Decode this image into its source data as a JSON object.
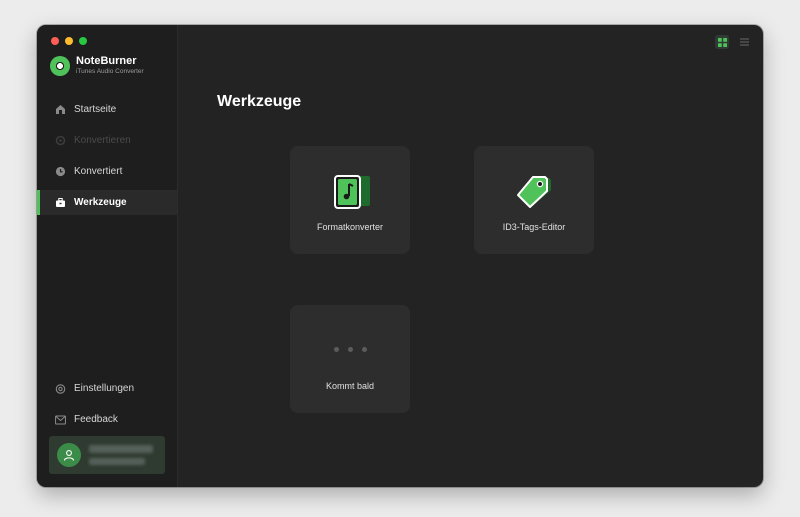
{
  "app": {
    "name": "NoteBurner",
    "subtitle": "iTunes Audio Converter"
  },
  "sidebar": {
    "items": [
      {
        "label": "Startseite",
        "icon": "home-icon",
        "state": "normal"
      },
      {
        "label": "Konvertieren",
        "icon": "convert-icon",
        "state": "disabled"
      },
      {
        "label": "Konvertiert",
        "icon": "clock-icon",
        "state": "normal"
      },
      {
        "label": "Werkzeuge",
        "icon": "toolbox-icon",
        "state": "active"
      }
    ],
    "bottom_items": [
      {
        "label": "Einstellungen",
        "icon": "gear-icon"
      },
      {
        "label": "Feedback",
        "icon": "mail-icon"
      }
    ]
  },
  "main": {
    "title": "Werkzeuge",
    "tools": [
      {
        "label": "Formatkonverter",
        "icon": "music-file-icon"
      },
      {
        "label": "ID3-Tags-Editor",
        "icon": "tag-icon"
      },
      {
        "label": "Kommt bald",
        "icon": "more-dots-icon"
      }
    ]
  },
  "colors": {
    "accent": "#4fc25a",
    "window_bg": "#232323",
    "sidebar_bg": "#1e1e1e",
    "card_bg": "#2d2d2d"
  }
}
